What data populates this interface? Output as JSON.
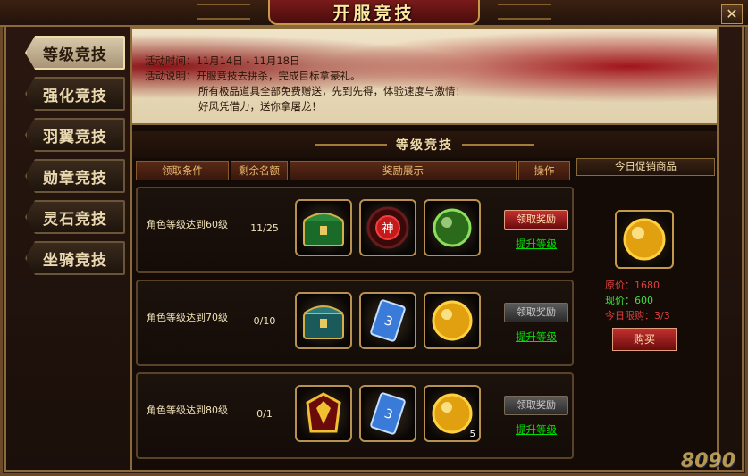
{
  "window": {
    "title": "开服竞技",
    "close": "✕"
  },
  "sidebar": {
    "items": [
      {
        "label": "等级竞技",
        "active": true
      },
      {
        "label": "强化竞技",
        "active": false
      },
      {
        "label": "羽翼竞技",
        "active": false
      },
      {
        "label": "勋章竞技",
        "active": false
      },
      {
        "label": "灵石竞技",
        "active": false
      },
      {
        "label": "坐骑竞技",
        "active": false
      }
    ]
  },
  "banner": {
    "time_label": "活动时间：",
    "time_value": "11月14日 - 11月18日",
    "desc_label": "活动说明：",
    "desc_line1": "开服竞技去拼杀，完成目标拿豪礼。",
    "desc_line2": "所有极品道具全部免费赠送，先到先得，体验速度与激情！",
    "desc_line3": "好风凭借力，送你拿屠龙！"
  },
  "section_title": "等级竞技",
  "columns": {
    "condition": "领取条件",
    "remaining": "剩余名额",
    "rewards": "奖励展示",
    "action": "操作"
  },
  "rows": [
    {
      "condition": "角色等级达到60级",
      "remaining": "11/25",
      "items": [
        {
          "icon": "green-chest-icon",
          "count": ""
        },
        {
          "icon": "red-god-seal-icon",
          "count": ""
        },
        {
          "icon": "green-orb-icon",
          "count": ""
        }
      ],
      "claim_label": "领取奖励",
      "claim_enabled": true,
      "level_link": "提升等级"
    },
    {
      "condition": "角色等级达到70级",
      "remaining": "0/10",
      "items": [
        {
          "icon": "teal-chest-icon",
          "count": ""
        },
        {
          "icon": "triple-exp-card-icon",
          "count": ""
        },
        {
          "icon": "gold-orb-icon",
          "count": ""
        }
      ],
      "claim_label": "领取奖励",
      "claim_enabled": false,
      "level_link": "提升等级"
    },
    {
      "condition": "角色等级达到80级",
      "remaining": "0/1",
      "items": [
        {
          "icon": "golden-armor-icon",
          "count": ""
        },
        {
          "icon": "triple-exp-card-icon",
          "count": ""
        },
        {
          "icon": "gold-orb-icon",
          "count": "5"
        }
      ],
      "claim_label": "领取奖励",
      "claim_enabled": false,
      "level_link": "提升等级"
    }
  ],
  "promo": {
    "title": "今日促销商品",
    "item_icon": "gold-orb-icon",
    "original_price": "原价：1680",
    "current_price": "现价：600",
    "limit": "今日限购：3/3",
    "buy_label": "购买"
  },
  "watermark": "8090",
  "colors": {
    "accent_red": "#c43030",
    "link_green": "#00e000",
    "gold_border": "#b89050"
  }
}
